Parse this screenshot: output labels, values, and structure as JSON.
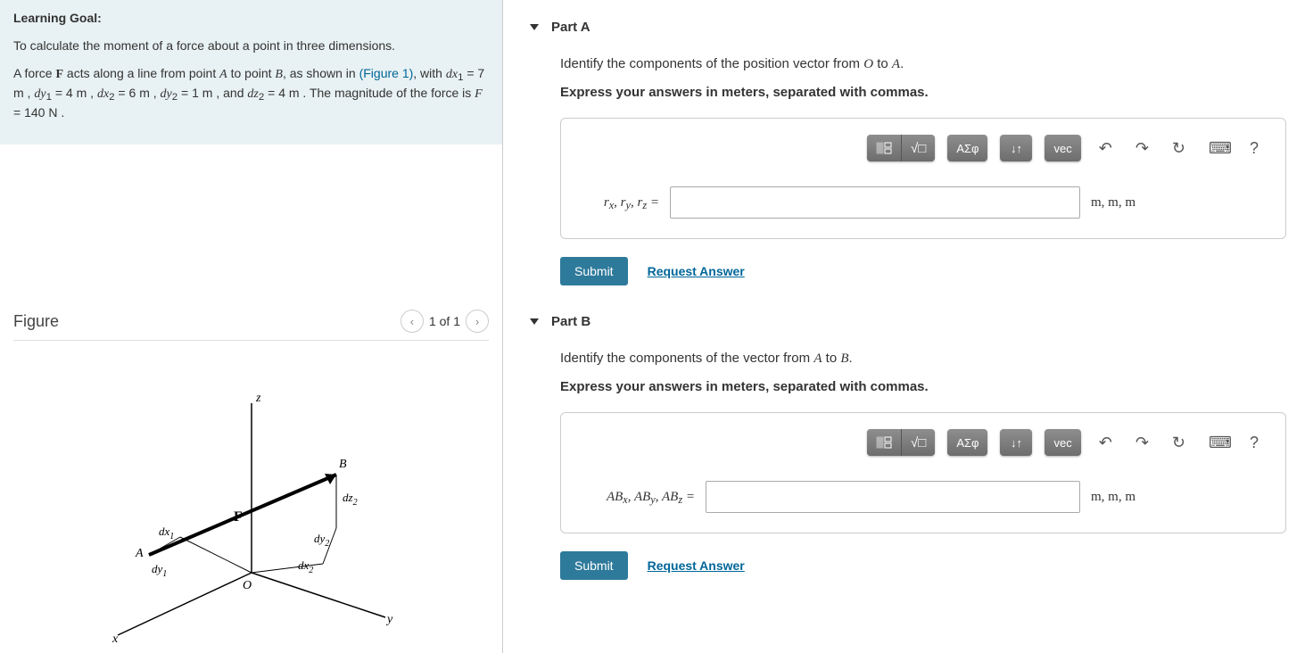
{
  "learning_goal": {
    "heading": "Learning Goal:",
    "intro": "To calculate the moment of a force about a point in three dimensions.",
    "figure_link": "(Figure 1)",
    "dx1": "7 m",
    "dy1": "4 m",
    "dx2": "6 m",
    "dy2": "1 m",
    "dz2": "4 m",
    "F": "140 N"
  },
  "figure": {
    "title": "Figure",
    "page": "1 of 1",
    "labels": {
      "A": "A",
      "B": "B",
      "O": "O",
      "F": "F",
      "x": "x",
      "y": "y",
      "z": "z",
      "dx1": "dx",
      "dy1": "dy",
      "dx2": "dx",
      "dy2": "dy",
      "dz2": "dz"
    }
  },
  "toolbar": {
    "template": "tmpl",
    "sqrt": "√",
    "greek": "ΑΣφ",
    "arrows": "↓↑",
    "vec": "vec",
    "undo": "↶",
    "redo": "↷",
    "reset": "↻",
    "keyboard": "⌨",
    "help": "?"
  },
  "parts": {
    "a": {
      "title": "Part A",
      "question_pre": "Identify the components of the position vector from ",
      "question_mid": " to ",
      "instruction": "Express your answers in meters, separated with commas.",
      "var_label": "rₓ, r_y, r_z =",
      "units": "m, m, m",
      "submit": "Submit",
      "request": "Request Answer"
    },
    "b": {
      "title": "Part B",
      "question_pre": "Identify the components of the vector from ",
      "question_mid": " to ",
      "instruction": "Express your answers in meters, separated with commas.",
      "var_label": "ABₓ, AB_y, AB_z =",
      "units": "m, m, m",
      "submit": "Submit",
      "request": "Request Answer"
    }
  }
}
